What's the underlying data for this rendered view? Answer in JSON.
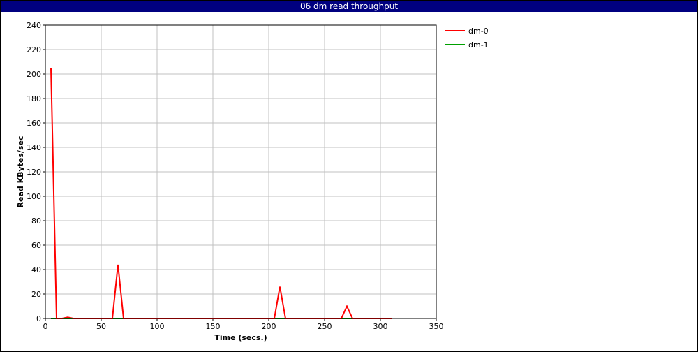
{
  "chart_data": {
    "type": "line",
    "title": "06 dm read throughput",
    "xlabel": "Time (secs.)",
    "ylabel": "Read KBytes/sec",
    "xlim": [
      0,
      350
    ],
    "ylim": [
      0,
      240
    ],
    "xticks": [
      0,
      50,
      100,
      150,
      200,
      250,
      300,
      350
    ],
    "yticks": [
      0,
      20,
      40,
      60,
      80,
      100,
      120,
      140,
      160,
      180,
      200,
      220,
      240
    ],
    "grid": true,
    "legend_position": "top-right outside",
    "series": [
      {
        "name": "dm-0",
        "color": "#ff0000",
        "x": [
          5,
          10,
          15,
          20,
          25,
          30,
          35,
          40,
          45,
          50,
          55,
          60,
          65,
          70,
          75,
          80,
          85,
          90,
          95,
          100,
          105,
          110,
          115,
          120,
          125,
          130,
          135,
          140,
          145,
          150,
          155,
          160,
          165,
          170,
          175,
          180,
          185,
          190,
          195,
          200,
          205,
          210,
          215,
          220,
          225,
          230,
          235,
          240,
          245,
          250,
          255,
          260,
          265,
          270,
          275,
          280,
          285,
          290,
          295,
          300,
          305,
          310
        ],
        "y": [
          205,
          0,
          0,
          1,
          0,
          0,
          0,
          0,
          0,
          0,
          0,
          0,
          44,
          0,
          0,
          0,
          0,
          0,
          0,
          0,
          0,
          0,
          0,
          0,
          0,
          0,
          0,
          0,
          0,
          0,
          0,
          0,
          0,
          0,
          0,
          0,
          0,
          0,
          0,
          0,
          0,
          26,
          0,
          0,
          0,
          0,
          0,
          0,
          0,
          0,
          0,
          0,
          0,
          10,
          0,
          0,
          0,
          0,
          0,
          0,
          0,
          0
        ]
      },
      {
        "name": "dm-1",
        "color": "#00a000",
        "x": [
          5,
          10,
          15,
          20,
          25,
          30,
          35,
          40,
          45,
          50,
          55,
          60,
          65,
          70,
          75,
          80,
          85,
          90,
          95,
          100,
          105,
          110,
          115,
          120,
          125,
          130,
          135,
          140,
          145,
          150,
          155,
          160,
          165,
          170,
          175,
          180,
          185,
          190,
          195,
          200,
          205,
          210,
          215,
          220,
          225,
          230,
          235,
          240,
          245,
          250,
          255,
          260,
          265,
          270,
          275,
          280,
          285,
          290,
          295,
          300,
          305,
          310
        ],
        "y": [
          0,
          0,
          0,
          0,
          0,
          0,
          0,
          0,
          0,
          0,
          0,
          0,
          0,
          0,
          0,
          0,
          0,
          0,
          0,
          0,
          0,
          0,
          0,
          0,
          0,
          0,
          0,
          0,
          0,
          0,
          0,
          0,
          0,
          0,
          0,
          0,
          0,
          0,
          0,
          0,
          0,
          0,
          0,
          0,
          0,
          0,
          0,
          0,
          0,
          0,
          0,
          0,
          0,
          0,
          0,
          0,
          0,
          0,
          0,
          0,
          0,
          0
        ]
      }
    ]
  }
}
